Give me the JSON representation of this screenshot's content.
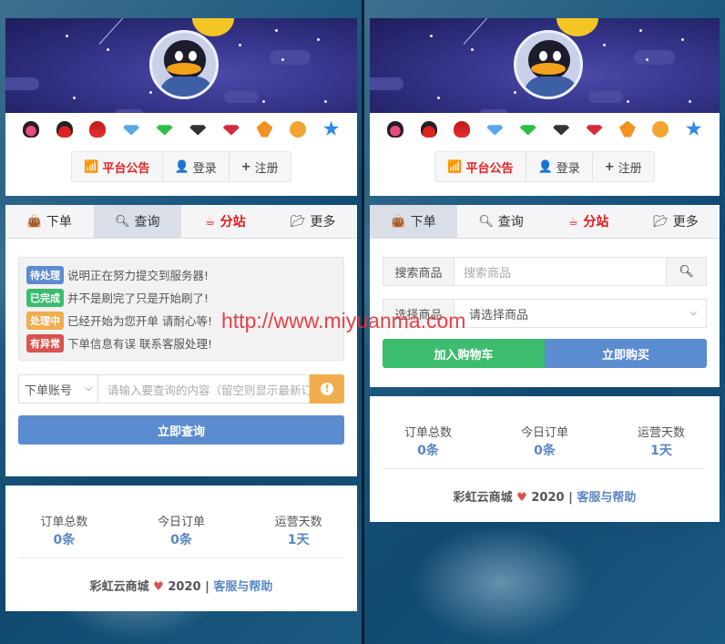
{
  "header": {
    "badges": [
      "qq-red-pink-icon",
      "qq-red-penguin-icon",
      "qq-red-hat-icon",
      "blue-diamond-icon",
      "green-diamond-icon",
      "black-diamond-icon",
      "red-diamond-icon",
      "orange-flame-icon",
      "yellow-ring-icon",
      "blue-star-icon"
    ],
    "buttons": {
      "notice": "平台公告",
      "login": "登录",
      "register": "注册"
    }
  },
  "tabs": [
    {
      "label": "下单",
      "icon": "shopping-bag-icon"
    },
    {
      "label": "查询",
      "icon": "search-icon"
    },
    {
      "label": "分站",
      "icon": "coffee-cup-icon"
    },
    {
      "label": "更多",
      "icon": "folder-open-icon"
    }
  ],
  "query_pane": {
    "statuses": [
      {
        "label": "待处理",
        "text": "说明正在努力提交到服务器!",
        "color": "#5b8ccf"
      },
      {
        "label": "已完成",
        "text": "并不是刷完了只是开始刷了!",
        "color": "#3cbc6e"
      },
      {
        "label": "处理中",
        "text": "已经开始为您开单 请耐心等!",
        "color": "#f0ad4e"
      },
      {
        "label": "有异常",
        "text": "下单信息有误 联系客服处理!",
        "color": "#d9534f"
      }
    ],
    "select_value": "下单账号",
    "input_placeholder": "请输入要查询的内容（留空则显示最新订单）",
    "submit": "立即查询"
  },
  "order_pane": {
    "search_label": "搜索商品",
    "search_placeholder": "搜索商品",
    "select_label": "选择商品",
    "select_value": "请选择商品",
    "add_cart": "加入购物车",
    "buy_now": "立即购买"
  },
  "stats": [
    {
      "key": "订单总数",
      "value": "0条"
    },
    {
      "key": "今日订单",
      "value": "0条"
    },
    {
      "key": "运营天数",
      "value": "1天"
    }
  ],
  "footer": {
    "brand": "彩虹云商城",
    "year": "2020",
    "sep": "|",
    "link": "客服与帮助"
  },
  "watermark": "http://www.miyuanma.com",
  "colors": {
    "primary": "#5b8ccf",
    "success": "#3cbc6e",
    "warning": "#f0ad4e",
    "danger": "#d9534f",
    "accent_red": "#e01818"
  }
}
